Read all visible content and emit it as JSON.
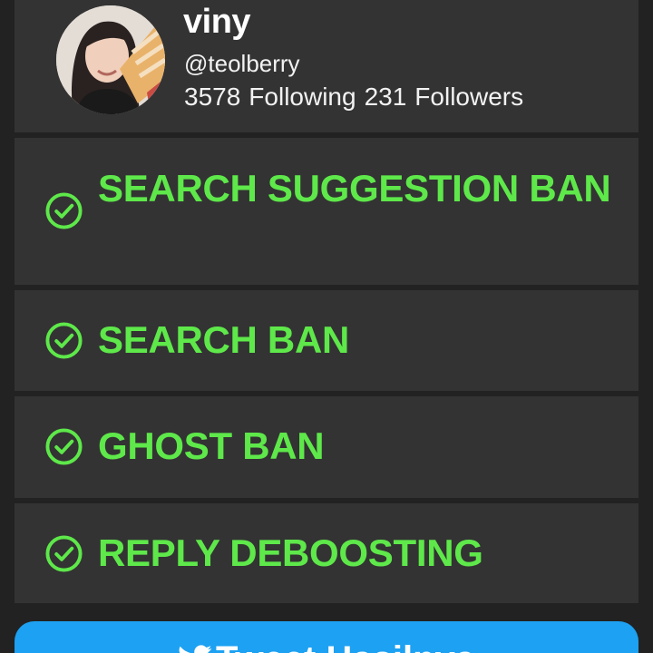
{
  "profile": {
    "name": "viny",
    "handle": "@teolberry",
    "following_count": "3578",
    "following_label": "Following",
    "followers_count": "231",
    "followers_label": "Followers"
  },
  "checks": [
    {
      "label": "SEARCH SUGGESTION BAN",
      "icon": "check-circle-icon",
      "status": "passed"
    },
    {
      "label": "SEARCH BAN",
      "icon": "check-circle-icon",
      "status": "passed"
    },
    {
      "label": "GHOST BAN",
      "icon": "check-circle-icon",
      "status": "passed"
    },
    {
      "label": "REPLY DEBOOSTING",
      "icon": "check-circle-icon",
      "status": "passed"
    }
  ],
  "tweet_button": {
    "label": "Tweet Hasilnya",
    "icon": "twitter-bird-icon"
  },
  "colors": {
    "background": "#222222",
    "card": "#333333",
    "status_ok": "#5ee84a",
    "button": "#1da1f2"
  }
}
